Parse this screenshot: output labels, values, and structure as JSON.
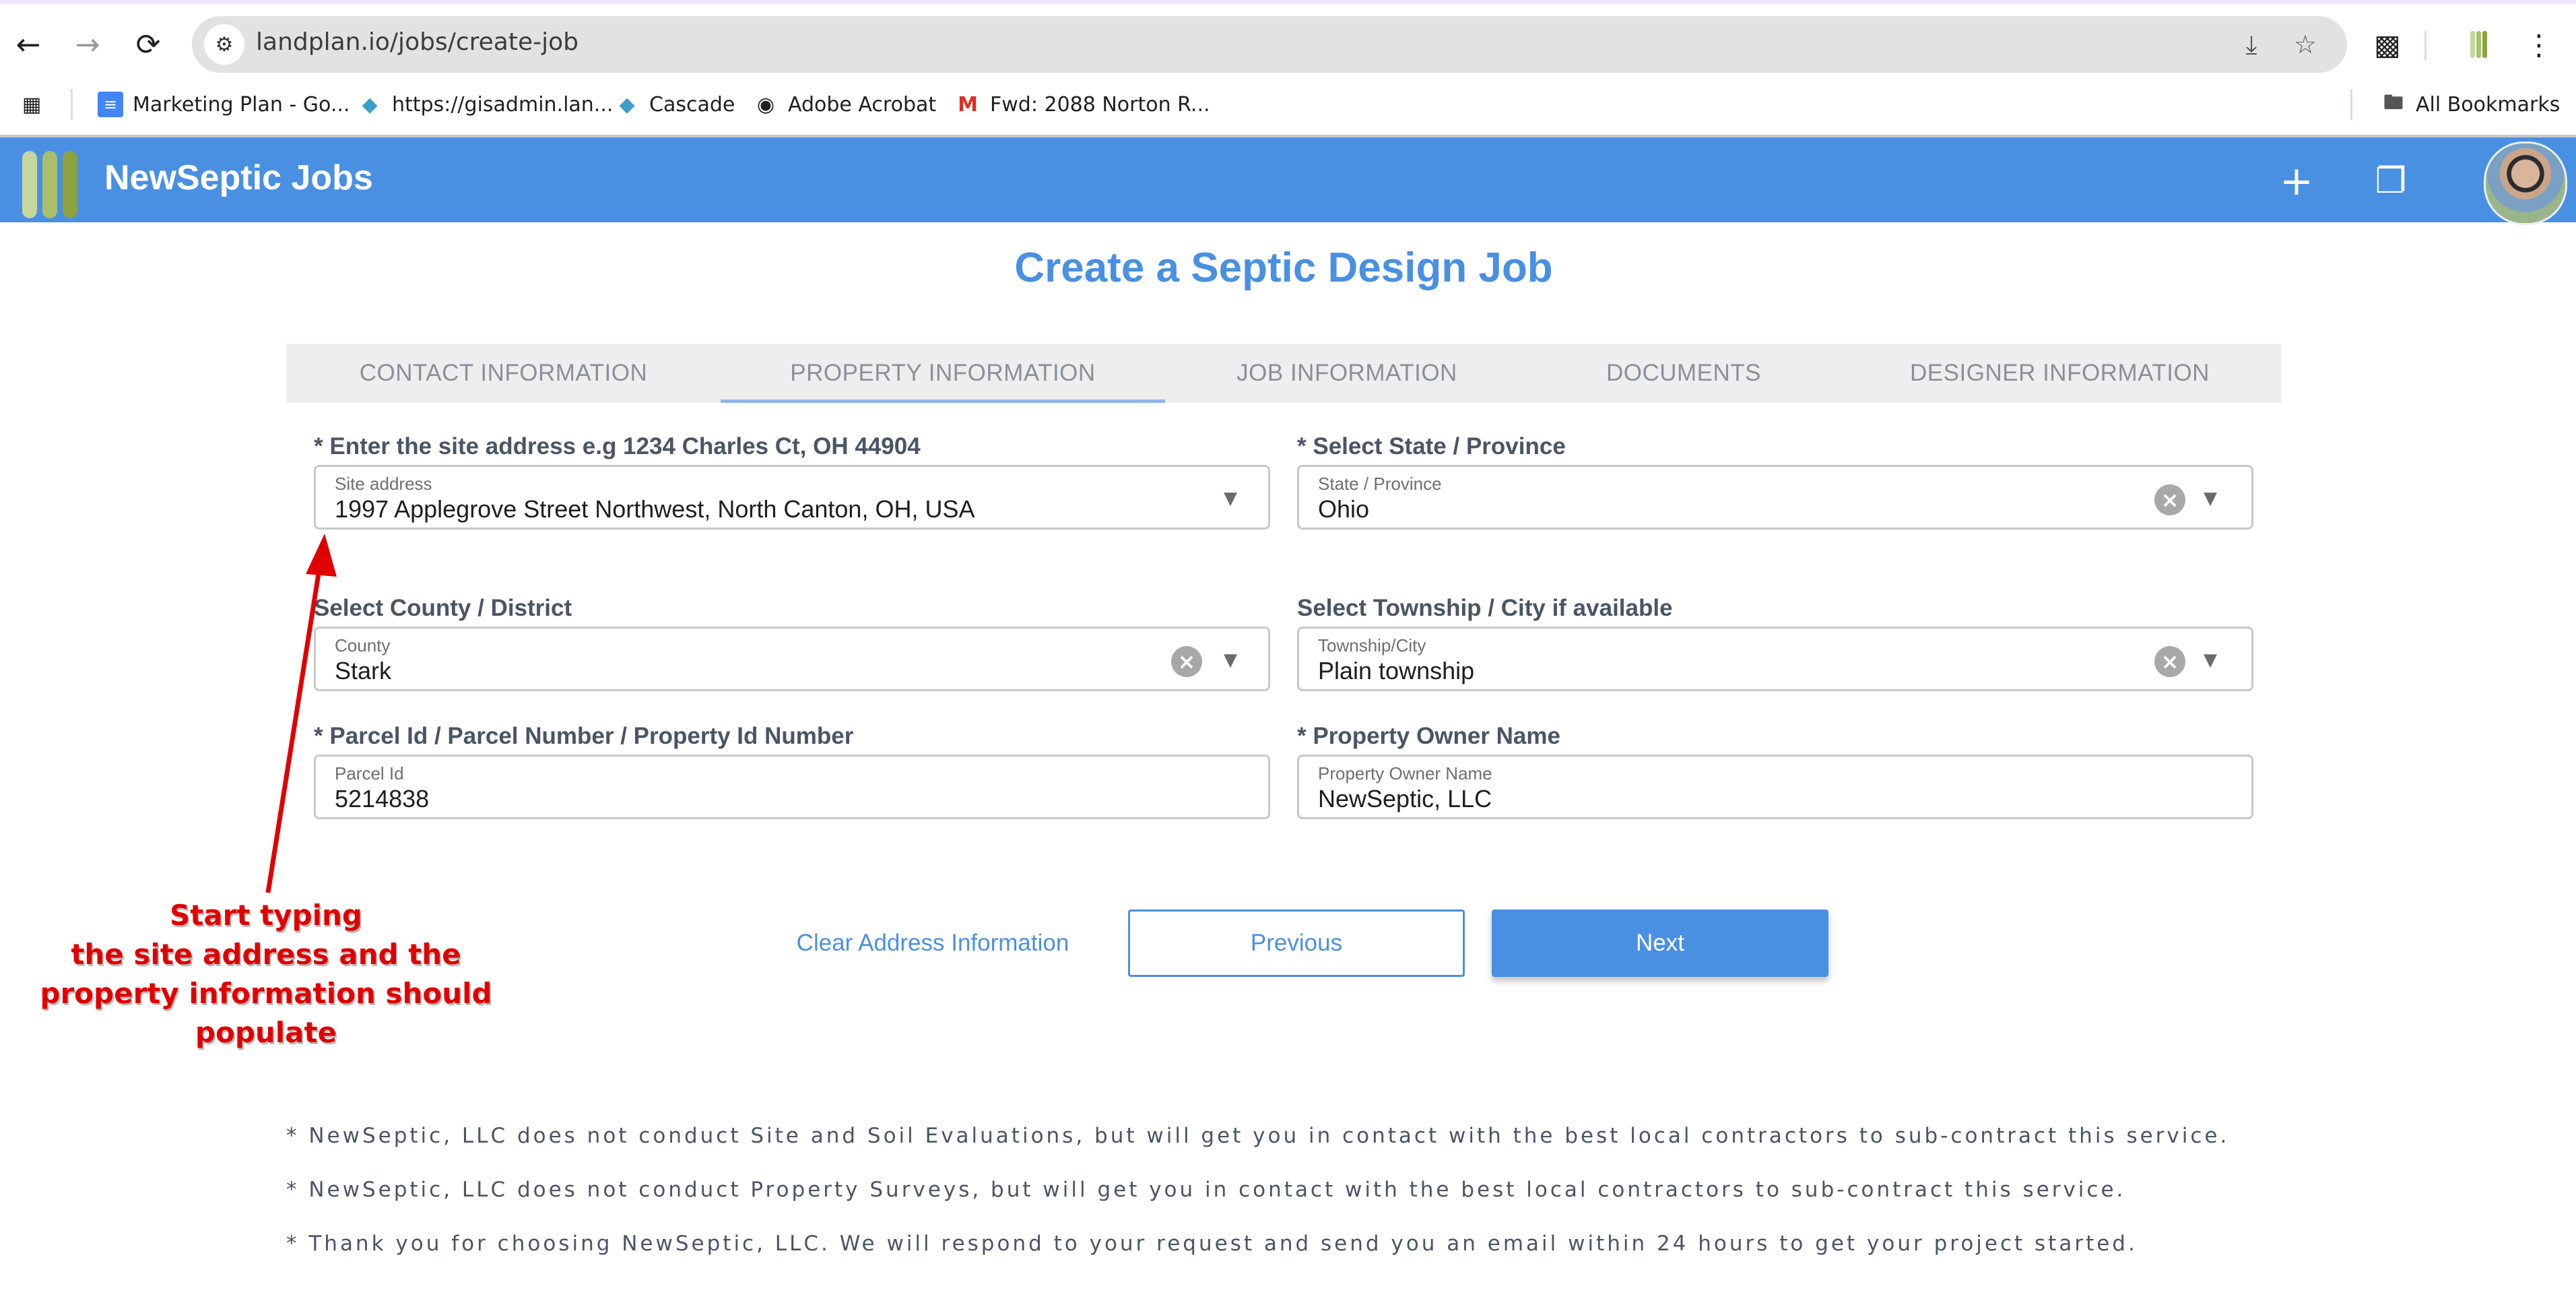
{
  "browser": {
    "url": "landplan.io/jobs/create-job",
    "nav": {
      "back": "back-arrow",
      "forward": "forward-arrow",
      "reload": "reload"
    },
    "bookmarks": [
      {
        "label": "Marketing Plan - Go...",
        "icon": "google-docs-icon"
      },
      {
        "label": "https://gisadmin.lan...",
        "icon": "globe-gis-icon"
      },
      {
        "label": "Cascade",
        "icon": "globe-gis-icon"
      },
      {
        "label": "Adobe Acrobat",
        "icon": "acrobat-icon"
      },
      {
        "label": "Fwd: 2088 Norton R...",
        "icon": "gmail-icon"
      }
    ],
    "all_bookmarks_label": "All Bookmarks"
  },
  "app": {
    "title": "NewSeptic Jobs",
    "brand_color": "#4a90e2",
    "logo_colors": [
      "#c6d69c",
      "#a9bf6b",
      "#8aa33a"
    ]
  },
  "page": {
    "title": "Create a Septic Design Job",
    "tabs": [
      {
        "label": "CONTACT INFORMATION",
        "active": false
      },
      {
        "label": "PROPERTY INFORMATION",
        "active": true
      },
      {
        "label": "JOB INFORMATION",
        "active": false
      },
      {
        "label": "DOCUMENTS",
        "active": false
      },
      {
        "label": "DESIGNER INFORMATION",
        "active": false
      }
    ]
  },
  "form": {
    "site_address": {
      "label": "* Enter the site address e.g 1234 Charles Ct, OH 44904",
      "caption": "Site address",
      "value": "1997 Applegrove Street Northwest, North Canton, OH, USA"
    },
    "state": {
      "label": "* Select State / Province",
      "caption": "State / Province",
      "value": "Ohio"
    },
    "county": {
      "label": "Select County / District",
      "caption": "County",
      "value": "Stark"
    },
    "township": {
      "label": "Select Township / City if available",
      "caption": "Township/City",
      "value": "Plain township"
    },
    "parcel": {
      "label": "* Parcel Id / Parcel Number / Property Id Number",
      "caption": "Parcel Id",
      "value": "5214838"
    },
    "owner": {
      "label": "* Property Owner Name",
      "caption": "Property Owner Name",
      "value": "NewSeptic, LLC"
    }
  },
  "actions": {
    "clear": "Clear Address Information",
    "previous": "Previous",
    "next": "Next"
  },
  "annotation": {
    "lines": [
      "Start typing",
      "the site address and the",
      "property information should",
      "populate"
    ]
  },
  "footnotes": [
    "* NewSeptic, LLC does not conduct Site and Soil Evaluations, but will get you in contact with the best local contractors to sub-contract this service.",
    "* NewSeptic, LLC does not conduct Property Surveys, but will get you in contact with the best local contractors to sub-contract this service.",
    "* Thank you for choosing NewSeptic, LLC. We will respond to your request and send you an email within 24 hours to get your project started."
  ]
}
